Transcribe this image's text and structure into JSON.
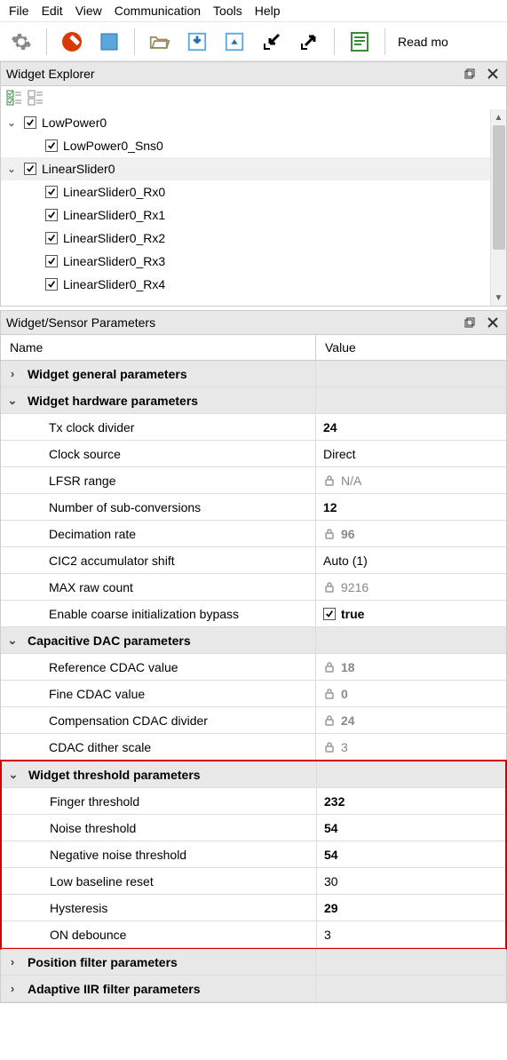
{
  "menu": {
    "file": "File",
    "edit": "Edit",
    "view": "View",
    "comm": "Communication",
    "tools": "Tools",
    "help": "Help"
  },
  "toolbar": {
    "readmore": "Read mo"
  },
  "explorer": {
    "title": "Widget Explorer",
    "items": [
      {
        "label": "LowPower0",
        "level": 0,
        "expander": "v",
        "selected": false
      },
      {
        "label": "LowPower0_Sns0",
        "level": 1,
        "expander": "",
        "selected": false
      },
      {
        "label": "LinearSlider0",
        "level": 0,
        "expander": "v",
        "selected": true
      },
      {
        "label": "LinearSlider0_Rx0",
        "level": 1,
        "expander": "",
        "selected": false
      },
      {
        "label": "LinearSlider0_Rx1",
        "level": 1,
        "expander": "",
        "selected": false
      },
      {
        "label": "LinearSlider0_Rx2",
        "level": 1,
        "expander": "",
        "selected": false
      },
      {
        "label": "LinearSlider0_Rx3",
        "level": 1,
        "expander": "",
        "selected": false
      },
      {
        "label": "LinearSlider0_Rx4",
        "level": 1,
        "expander": "",
        "selected": false
      }
    ]
  },
  "params": {
    "title": "Widget/Sensor Parameters",
    "cols": {
      "name": "Name",
      "value": "Value"
    },
    "rows": [
      {
        "type": "group",
        "exp": ">",
        "label": "Widget general parameters"
      },
      {
        "type": "group",
        "exp": "v",
        "label": "Widget hardware parameters"
      },
      {
        "type": "item",
        "label": "Tx clock divider",
        "value": "24",
        "bold": true
      },
      {
        "type": "item",
        "label": "Clock source",
        "value": "Direct"
      },
      {
        "type": "item",
        "label": "LFSR range",
        "value": "N/A",
        "locked": true
      },
      {
        "type": "item",
        "label": "Number of sub-conversions",
        "value": "12",
        "bold": true
      },
      {
        "type": "item",
        "label": "Decimation rate",
        "value": "96",
        "locked": true,
        "boldlocked": true
      },
      {
        "type": "item",
        "label": "CIC2 accumulator shift",
        "value": "Auto (1)"
      },
      {
        "type": "item",
        "label": "MAX raw count",
        "value": "9216",
        "locked": true
      },
      {
        "type": "item",
        "label": "Enable coarse initialization bypass",
        "value": "true",
        "checkbox": true,
        "bold": true
      },
      {
        "type": "group",
        "exp": "v",
        "label": "Capacitive DAC parameters"
      },
      {
        "type": "item",
        "label": "Reference CDAC value",
        "value": "18",
        "locked": true,
        "boldlocked": true
      },
      {
        "type": "item",
        "label": "Fine CDAC value",
        "value": "0",
        "locked": true,
        "boldlocked": true
      },
      {
        "type": "item",
        "label": "Compensation CDAC divider",
        "value": "24",
        "locked": true,
        "boldlocked": true
      },
      {
        "type": "item",
        "label": "CDAC dither scale",
        "value": "3",
        "locked": true
      },
      {
        "type": "hl-start"
      },
      {
        "type": "group",
        "exp": "v",
        "label": "Widget threshold parameters"
      },
      {
        "type": "item",
        "label": "Finger threshold",
        "value": "232",
        "bold": true
      },
      {
        "type": "item",
        "label": "Noise threshold",
        "value": "54",
        "bold": true
      },
      {
        "type": "item",
        "label": "Negative noise threshold",
        "value": "54",
        "bold": true
      },
      {
        "type": "item",
        "label": "Low baseline reset",
        "value": "30"
      },
      {
        "type": "item",
        "label": "Hysteresis",
        "value": "29",
        "bold": true
      },
      {
        "type": "item",
        "label": "ON debounce",
        "value": "3"
      },
      {
        "type": "hl-end"
      },
      {
        "type": "group",
        "exp": ">",
        "label": "Position filter parameters"
      },
      {
        "type": "group",
        "exp": ">",
        "label": "Adaptive IIR filter parameters"
      }
    ]
  }
}
